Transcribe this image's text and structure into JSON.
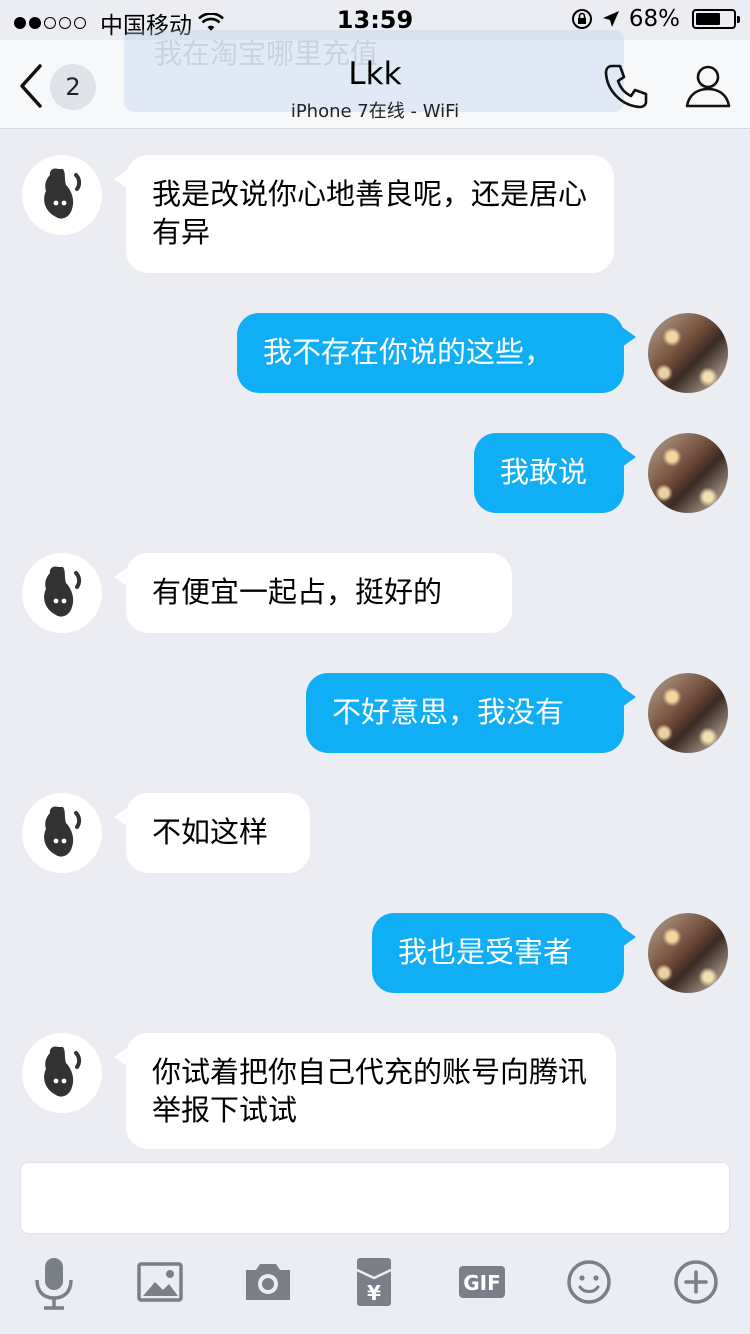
{
  "status_bar": {
    "signal_full": 2,
    "signal_total": 5,
    "carrier": "中国移动",
    "time": "13:59",
    "battery": "68%",
    "battery_level": 0.68
  },
  "ghost_banner": {
    "text": "我在淘宝哪里充值"
  },
  "header": {
    "back_count": "2",
    "title": "Lkk",
    "subtitle": "iPhone 7在线 - WiFi"
  },
  "messages": [
    {
      "side": "left",
      "text": "我是改说你心地善良呢，还是居心有异"
    },
    {
      "side": "right",
      "text": "我不存在你说的这些，"
    },
    {
      "side": "right",
      "text": "我敢说"
    },
    {
      "side": "left",
      "text": "有便宜一起占，挺好的"
    },
    {
      "side": "right",
      "text": "不好意思，我没有"
    },
    {
      "side": "left",
      "text": "不如这样"
    },
    {
      "side": "right",
      "text": "我也是受害者"
    },
    {
      "side": "left",
      "text": "你试着把你自己代充的账号向腾讯举报下试试"
    }
  ],
  "input": {
    "placeholder": ""
  },
  "toolbar": {
    "icons": [
      "microphone-icon",
      "image-icon",
      "camera-icon",
      "red-packet-icon",
      "gif-icon",
      "emoji-icon",
      "plus-icon"
    ],
    "gif_label": "GIF",
    "yuan_label": "¥"
  },
  "colors": {
    "accent": "#10aef5",
    "background": "#ebedf2",
    "icon_gray": "#7b7f88"
  }
}
